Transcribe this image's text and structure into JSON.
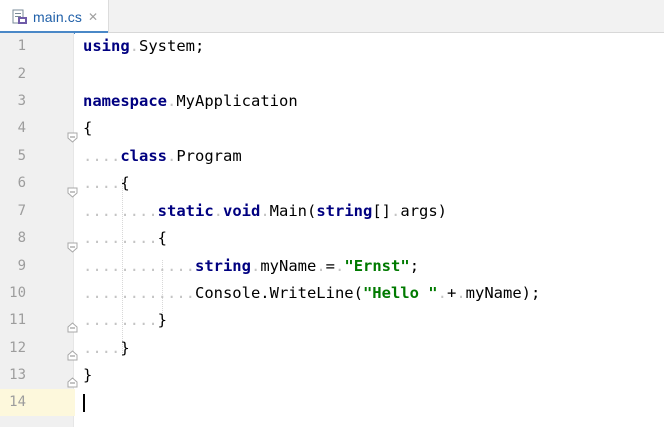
{
  "tab": {
    "file_name": "main.cs",
    "close_glyph": "✕",
    "icon": "csharp-file-icon"
  },
  "gutter": {
    "line_numbers": [
      "1",
      "2",
      "3",
      "4",
      "5",
      "6",
      "7",
      "8",
      "9",
      "10",
      "11",
      "12",
      "13",
      "14"
    ]
  },
  "code": {
    "l1_kw": "using",
    "l1_rest": "System;",
    "l3_kw": "namespace",
    "l3_rest": "MyApplication",
    "l4": "{",
    "l5_kw": "class",
    "l5_rest": "Program",
    "l6": "{",
    "l7_kw1": "static",
    "l7_kw2": "void",
    "l7_mid": "Main(",
    "l7_kw3": "string",
    "l7_end": "[]",
    "l7_args": "args)",
    "l8": "{",
    "l9_kw": "string",
    "l9_var": "myName",
    "l9_eq": "=",
    "l9_str": "\"Ernst\"",
    "l9_end": ";",
    "l10_call": "Console.WriteLine(",
    "l10_str": "\"Hello \"",
    "l10_plus": "+",
    "l10_end": "myName);",
    "l11": "}",
    "l12": "}",
    "l13": "}"
  },
  "colors": {
    "keyword": "#000080",
    "string": "#007a00",
    "current_line": "#fdf8dc",
    "tab_accent": "#4a88c7"
  }
}
